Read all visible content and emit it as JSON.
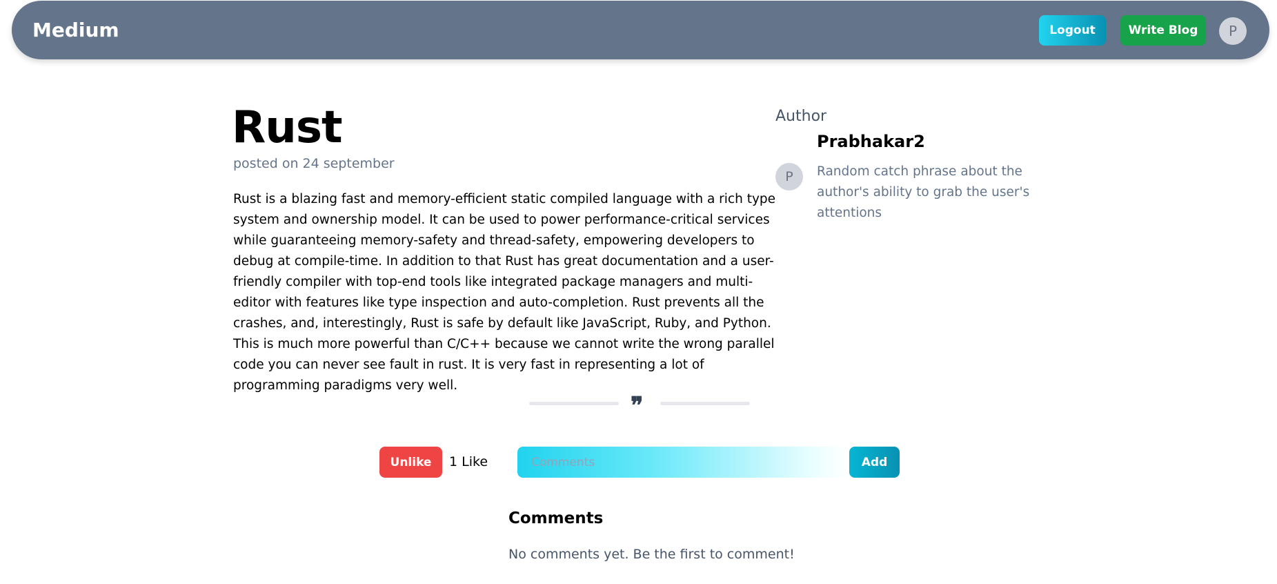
{
  "nav": {
    "brand": "Medium",
    "logout": "Logout",
    "write": "Write Blog",
    "avatar": "P"
  },
  "post": {
    "title": "Rust",
    "date": "posted on 24 september",
    "body": "Rust is a blazing fast and memory-efficient static compiled language with a rich type system and ownership model. It can be used to power performance-critical services while guaranteeing memory-safety and thread-safety, empowering developers to debug at compile-time. In addition to that Rust has great documentation and a user-friendly compiler with top-end tools like integrated package managers and multi-editor with features like type inspection and auto-completion. Rust prevents all the crashes, and, interestingly, Rust is safe by default like JavaScript, Ruby, and Python. This is much more powerful than C/C++ because we cannot write the wrong parallel code you can never see fault in rust. It is very fast in representing a lot of programming paradigms very well."
  },
  "author": {
    "label": "Author",
    "name": "Prabhakar2",
    "avatar": "P",
    "phrase": "Random catch phrase about the author's ability to grab the user's attentions"
  },
  "actions": {
    "unlike": "Unlike",
    "likes": "1 Like",
    "comment_placeholder": "Comments",
    "add": "Add"
  },
  "comments": {
    "heading": "Comments",
    "empty": "No comments yet. Be the first to comment!"
  },
  "quote_icon": "❞"
}
